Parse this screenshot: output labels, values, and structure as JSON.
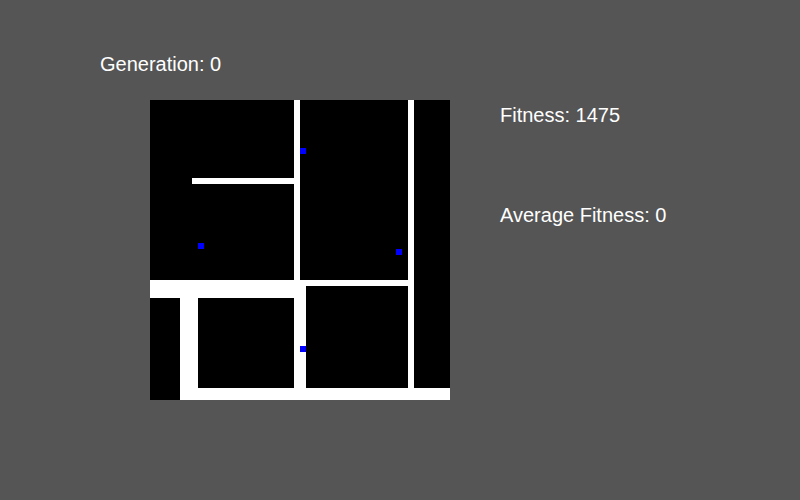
{
  "generation": {
    "label": "Generation: 0"
  },
  "stats": [
    {
      "label": "Fitness: 1475"
    },
    {
      "label": "Average Fitness: 0"
    }
  ]
}
